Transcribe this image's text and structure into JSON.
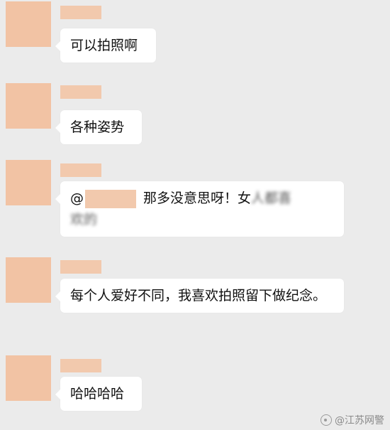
{
  "messages": [
    {
      "text": "可以拍照啊"
    },
    {
      "text": "各种姿势"
    },
    {
      "prefix": "@",
      "text": "那多没意思呀！女",
      "blurred_tail": "人都喜",
      "blurred_line2": "欢的"
    },
    {
      "text": "每个人爱好不同，我喜欢拍照留下做纪念。"
    },
    {
      "text": "哈哈哈哈"
    }
  ],
  "watermark": {
    "text": "@江苏网警",
    "icon": "weibo-icon"
  },
  "colors": {
    "background": "#ebebeb",
    "avatar_mask": "#f2c3a4",
    "bubble": "#ffffff"
  }
}
